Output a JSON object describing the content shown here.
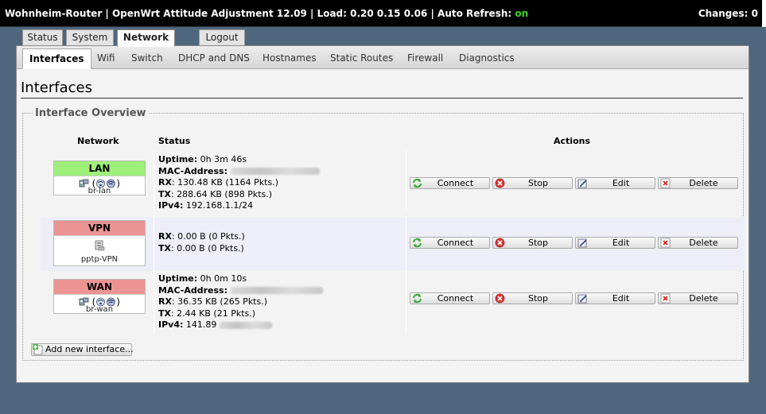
{
  "header": {
    "left_text": "Wohnheim-Router | OpenWrt Attitude Adjustment 12.09 | Load: 0.20 0.15 0.06 | Auto Refresh: ",
    "auto_refresh_state": "on",
    "changes_label": "Changes: 0",
    "colors": {
      "bar": "#000000",
      "on": "#3ed326"
    }
  },
  "main_tabs": [
    {
      "label": "Status"
    },
    {
      "label": "System"
    },
    {
      "label": "Network",
      "active": true
    },
    {
      "label": "Logout"
    }
  ],
  "sub_tabs": [
    {
      "label": "Interfaces",
      "active": true
    },
    {
      "label": "Wifi"
    },
    {
      "label": "Switch"
    },
    {
      "label": "DHCP and DNS"
    },
    {
      "label": "Hostnames"
    },
    {
      "label": "Static Routes"
    },
    {
      "label": "Firewall"
    },
    {
      "label": "Diagnostics"
    }
  ],
  "page": {
    "title": "Interfaces",
    "section_legend": "Interface Overview",
    "columns": {
      "network": "Network",
      "status": "Status",
      "actions": "Actions"
    }
  },
  "interfaces": [
    {
      "name": "LAN",
      "color": "#9ef07a",
      "device": "br-lan",
      "icons": [
        "ethernet-icon",
        "wifi-icon",
        "wifi-icon"
      ],
      "status": {
        "uptime_label": "Uptime:",
        "uptime": "0h 3m 46s",
        "mac_label": "MAC-Address:",
        "mac": "",
        "rx_label": "RX",
        "rx": ": 130.48 KB (1164 Pkts.)",
        "tx_label": "TX",
        "tx": ": 288.64 KB (898 Pkts.)",
        "ipv4_label": "IPv4:",
        "ipv4": "192.168.1.1/24"
      }
    },
    {
      "name": "VPN",
      "color": "#ec9494",
      "device": "pptp-VPN",
      "icons": [
        "tunnel-icon"
      ],
      "status": {
        "rx_label": "RX",
        "rx": ": 0.00 B (0 Pkts.)",
        "tx_label": "TX",
        "tx": ": 0.00 B (0 Pkts.)"
      }
    },
    {
      "name": "WAN",
      "color": "#ec9494",
      "device": "br-wan",
      "icons": [
        "ethernet-icon",
        "wifi-icon",
        "wifi-icon"
      ],
      "status": {
        "uptime_label": "Uptime:",
        "uptime": "0h 0m 10s",
        "mac_label": "MAC-Address:",
        "mac": "",
        "rx_label": "RX",
        "rx": ": 36.35 KB (265 Pkts.)",
        "tx_label": "TX",
        "tx": ": 2.44 KB (21 Pkts.)",
        "ipv4_label": "IPv4:",
        "ipv4": "141.89"
      }
    }
  ],
  "actions": {
    "connect": "Connect",
    "stop": "Stop",
    "edit": "Edit",
    "delete": "Delete"
  },
  "add_interface_label": "Add new interface..."
}
